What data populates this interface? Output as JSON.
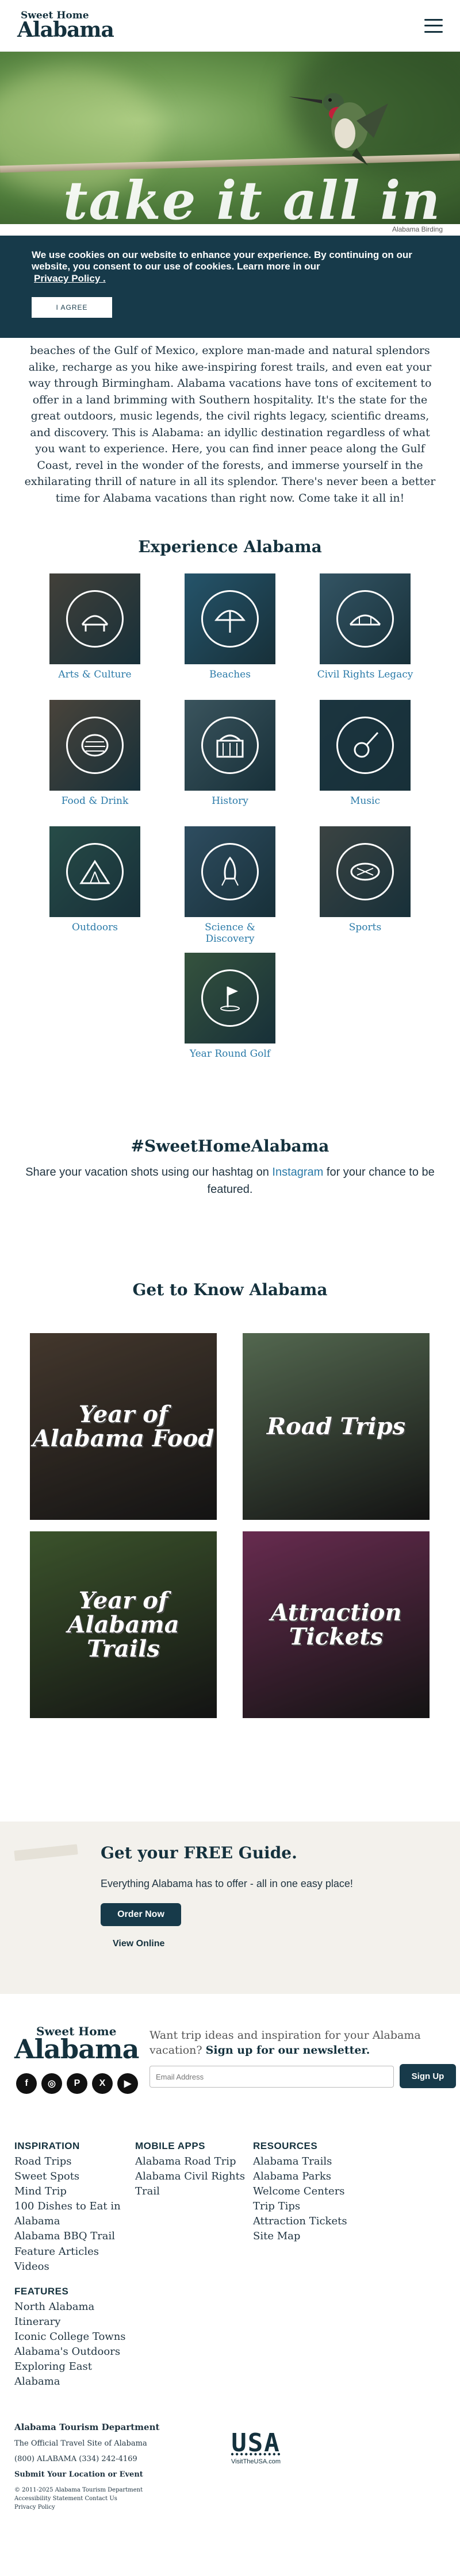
{
  "header": {
    "logo_line1": "Sweet Home",
    "logo_line2": "Alabama"
  },
  "hero": {
    "title": "take it all in",
    "caption": "Alabama Birding"
  },
  "cookie": {
    "message": "We use cookies on our website to enhance your experience. By continuing on our website, you consent to our use of cookies. Learn more in our",
    "link": "Privacy Policy .",
    "button": "I AGREE"
  },
  "intro": {
    "text": "beaches of the Gulf of Mexico, explore man-made and natural splendors alike, recharge as you hike awe-inspiring forest trails, and even eat your way through Birmingham. Alabama vacations have tons of excitement to offer in a land brimming with Southern hospitality. It's the state for the great outdoors, music legends, the civil rights legacy, scientific dreams, and discovery. This is Alabama: an idyllic destination regardless of what you want to experience. Here, you can find inner peace along the Gulf Coast, revel in the wonder of the forests, and immerse yourself in the exhilarating thrill of nature in all its splendor. There's never been a better time for Alabama vacations than right now. Come take it all in!"
  },
  "experience": {
    "heading": "Experience Alabama",
    "categories": [
      {
        "label": "Arts & Culture",
        "color": "#7a5236",
        "icon": "theater-icon"
      },
      {
        "label": "Beaches",
        "color": "#3a7fa3",
        "icon": "umbrella-icon"
      },
      {
        "label": "Civil Rights Legacy",
        "color": "#5a7f94",
        "icon": "bridge-icon"
      },
      {
        "label": "Food & Drink",
        "color": "#8a5a3a",
        "icon": "bbq-icon"
      },
      {
        "label": "History",
        "color": "#6a7f86",
        "icon": "capitol-icon"
      },
      {
        "label": "Music",
        "color": "#263a44",
        "icon": "guitar-icon"
      },
      {
        "label": "Outdoors",
        "color": "#3f6d56",
        "icon": "tent-icon"
      },
      {
        "label": "Science & Discovery",
        "color": "#4f6f8c",
        "icon": "rocket-icon"
      },
      {
        "label": "Sports",
        "color": "#6b5a4a",
        "icon": "stadium-icon"
      },
      {
        "label": "Year Round Golf",
        "color": "#5e7c3f",
        "icon": "golf-flag-icon"
      }
    ]
  },
  "hashtag": {
    "heading": "#SweetHomeAlabama",
    "text_before": "Share your vacation shots using our hashtag on ",
    "link": "Instagram",
    "text_after": " for your chance to be featured."
  },
  "get_to_know": {
    "heading": "Get to Know Alabama",
    "cards": [
      {
        "title": "Year of Alabama Food",
        "color": "#5a4a3c"
      },
      {
        "title": "Road Trips",
        "color": "#6f8a6a"
      },
      {
        "title": "Year of Alabama Trails",
        "color": "#4f6f3a"
      },
      {
        "title": "Attraction Tickets",
        "color": "#8a3a6a"
      }
    ]
  },
  "guide": {
    "heading": "Get your FREE Guide.",
    "text": "Everything Alabama has to offer - all in one easy place!",
    "order_button": "Order Now",
    "view_link": "View Online"
  },
  "footer": {
    "logo_line1": "Sweet Home",
    "logo_line2": "Alabama",
    "tagline": "Want trip ideas and inspiration for your Alabama vacation?",
    "tagline_bold": "Sign up for our newsletter.",
    "email_placeholder": "Email Address",
    "signup_button": "Sign Up",
    "socials": [
      {
        "icon": "facebook-icon",
        "glyph": "f"
      },
      {
        "icon": "instagram-icon",
        "glyph": "◎"
      },
      {
        "icon": "pinterest-icon",
        "glyph": "P"
      },
      {
        "icon": "x-icon",
        "glyph": "X"
      },
      {
        "icon": "youtube-icon",
        "glyph": "▶"
      }
    ],
    "inspiration": {
      "heading": "INSPIRATION",
      "links": [
        "Road Trips",
        "Sweet Spots",
        "Mind Trip",
        "100 Dishes to Eat in Alabama",
        "Alabama BBQ Trail",
        "Feature Articles",
        "Videos"
      ]
    },
    "mobile_apps": {
      "heading": "MOBILE APPS",
      "links": [
        "Alabama Road Trip",
        "Alabama Civil Rights Trail"
      ]
    },
    "resources": {
      "heading": "RESOURCES",
      "links": [
        "Alabama Trails",
        "Alabama Parks",
        "Welcome Centers",
        "Trip Tips",
        "Attraction Tickets",
        "Site Map"
      ]
    },
    "features": {
      "heading": "FEATURES",
      "links": [
        "North Alabama Itinerary",
        "Iconic College Towns",
        "Alabama's Outdoors",
        "Exploring East Alabama"
      ]
    },
    "org": {
      "name": "Alabama Tourism Department",
      "subtitle": "The Official Travel Site of Alabama",
      "phone": "(800) ALABAMA (334) 242-4169",
      "submit": "Submit Your Location or Event",
      "copyright": "© 2011-2025 Alabama Tourism Department",
      "links": "Accessibility Statement   Contact Us",
      "privacy": "Privacy Policy"
    },
    "usa_logo": {
      "word": "USA",
      "sub": "VisitTheUSA.com"
    }
  }
}
